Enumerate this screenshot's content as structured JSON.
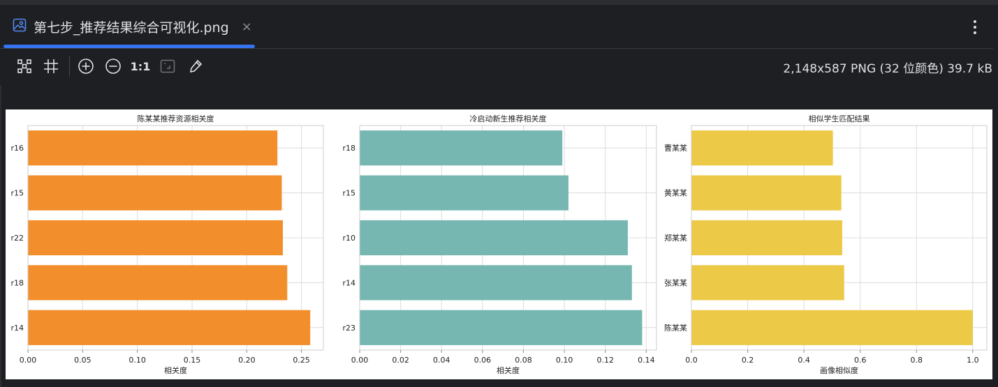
{
  "tab": {
    "title": "第七步_推荐结果综合可视化.png",
    "close_glyph": "×",
    "icon": "image-file-icon"
  },
  "toolbar": {
    "fit_icon": "fit-to-window-icon",
    "grid_icon": "grid-icon",
    "zoom_in_icon": "zoom-in-icon",
    "zoom_out_icon": "zoom-out-icon",
    "actual_size_label": "1:1",
    "fit_size_icon": "fit-size-icon",
    "color_picker_icon": "color-picker-icon",
    "more_icon": "more-vertical-icon"
  },
  "image_info": "2,148x587 PNG (32 位颜色) 39.7 kB",
  "colors": {
    "accent": "#3574f0",
    "orange": "#f28e2b",
    "teal": "#76b7b2",
    "yellow": "#edc948"
  },
  "chart_data": [
    {
      "type": "bar",
      "orientation": "horizontal",
      "title": "陈某某推荐资源相关度",
      "xlabel": "相关度",
      "ylabel": "",
      "categories": [
        "r16",
        "r15",
        "r22",
        "r18",
        "r14"
      ],
      "values": [
        0.228,
        0.232,
        0.233,
        0.237,
        0.258
      ],
      "xlim": [
        0,
        0.27
      ],
      "xticks": [
        "0.00",
        "0.05",
        "0.10",
        "0.15",
        "0.20",
        "0.25"
      ],
      "xtick_values": [
        0,
        0.05,
        0.1,
        0.15,
        0.2,
        0.25
      ],
      "grid": true,
      "color": "#f28e2b"
    },
    {
      "type": "bar",
      "orientation": "horizontal",
      "title": "冷启动新生推荐相关度",
      "xlabel": "相关度",
      "ylabel": "",
      "categories": [
        "r18",
        "r15",
        "r10",
        "r14",
        "r23"
      ],
      "values": [
        0.099,
        0.102,
        0.131,
        0.133,
        0.138
      ],
      "xlim": [
        0,
        0.145
      ],
      "xticks": [
        "0.00",
        "0.02",
        "0.04",
        "0.06",
        "0.08",
        "0.10",
        "0.12",
        "0.14"
      ],
      "xtick_values": [
        0,
        0.02,
        0.04,
        0.06,
        0.08,
        0.1,
        0.12,
        0.14
      ],
      "grid": true,
      "color": "#76b7b2"
    },
    {
      "type": "bar",
      "orientation": "horizontal",
      "title": "相似学生匹配结果",
      "xlabel": "画像相似度",
      "ylabel": "",
      "categories": [
        "曹某某",
        "黄某某",
        "郑某某",
        "张某某",
        "陈某某"
      ],
      "values": [
        0.503,
        0.533,
        0.536,
        0.543,
        1.0
      ],
      "xlim": [
        0,
        1.05
      ],
      "xticks": [
        "0.0",
        "0.2",
        "0.4",
        "0.6",
        "0.8",
        "1.0"
      ],
      "xtick_values": [
        0,
        0.2,
        0.4,
        0.6,
        0.8,
        1.0
      ],
      "grid": true,
      "color": "#edc948"
    }
  ]
}
